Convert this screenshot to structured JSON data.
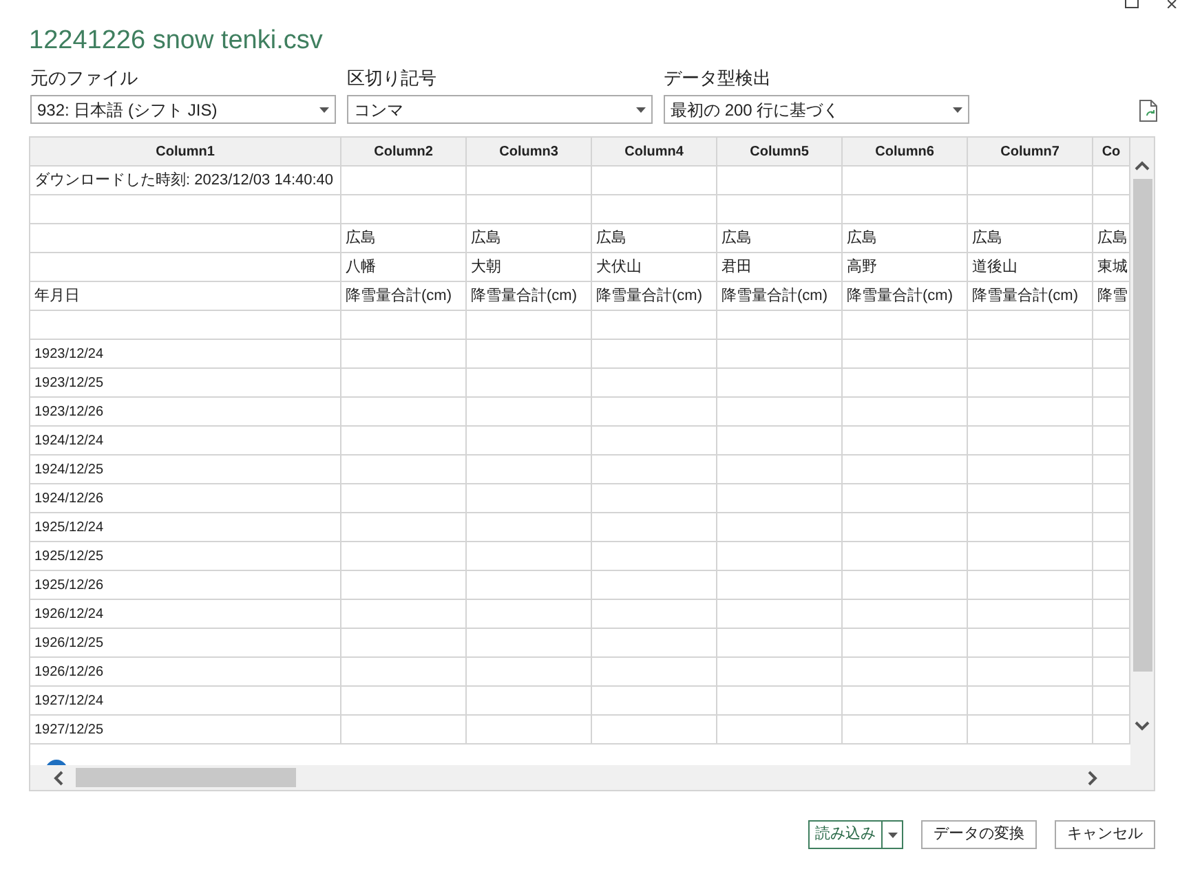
{
  "window": {
    "title": "12241226 snow tenki.csv"
  },
  "options": [
    {
      "label": "元のファイル",
      "value": "932: 日本語 (シフト JIS)"
    },
    {
      "label": "区切り記号",
      "value": "コンマ"
    },
    {
      "label": "データ型検出",
      "value": "最初の 200 行に基づく"
    }
  ],
  "table": {
    "columns": [
      "Column1",
      "Column2",
      "Column3",
      "Column4",
      "Column5",
      "Column6",
      "Column7",
      "Co"
    ],
    "rows": [
      [
        "ダウンロードした時刻: 2023/12/03 14:40:40",
        "",
        "",
        "",
        "",
        "",
        "",
        ""
      ],
      [
        "",
        "",
        "",
        "",
        "",
        "",
        "",
        ""
      ],
      [
        "",
        "広島",
        "広島",
        "広島",
        "広島",
        "広島",
        "広島",
        "広島"
      ],
      [
        "",
        "八幡",
        "大朝",
        "犬伏山",
        "君田",
        "高野",
        "道後山",
        "東城"
      ],
      [
        "年月日",
        "降雪量合計(cm)",
        "降雪量合計(cm)",
        "降雪量合計(cm)",
        "降雪量合計(cm)",
        "降雪量合計(cm)",
        "降雪量合計(cm)",
        "降雪"
      ],
      [
        "",
        "",
        "",
        "",
        "",
        "",
        "",
        ""
      ],
      [
        "1923/12/24",
        "",
        "",
        "",
        "",
        "",
        "",
        ""
      ],
      [
        "1923/12/25",
        "",
        "",
        "",
        "",
        "",
        "",
        ""
      ],
      [
        "1923/12/26",
        "",
        "",
        "",
        "",
        "",
        "",
        ""
      ],
      [
        "1924/12/24",
        "",
        "",
        "",
        "",
        "",
        "",
        ""
      ],
      [
        "1924/12/25",
        "",
        "",
        "",
        "",
        "",
        "",
        ""
      ],
      [
        "1924/12/26",
        "",
        "",
        "",
        "",
        "",
        "",
        ""
      ],
      [
        "1925/12/24",
        "",
        "",
        "",
        "",
        "",
        "",
        ""
      ],
      [
        "1925/12/25",
        "",
        "",
        "",
        "",
        "",
        "",
        ""
      ],
      [
        "1925/12/26",
        "",
        "",
        "",
        "",
        "",
        "",
        ""
      ],
      [
        "1926/12/24",
        "",
        "",
        "",
        "",
        "",
        "",
        ""
      ],
      [
        "1926/12/25",
        "",
        "",
        "",
        "",
        "",
        "",
        ""
      ],
      [
        "1926/12/26",
        "",
        "",
        "",
        "",
        "",
        "",
        ""
      ],
      [
        "1927/12/24",
        "",
        "",
        "",
        "",
        "",
        "",
        ""
      ],
      [
        "1927/12/25",
        "",
        "",
        "",
        "",
        "",
        "",
        ""
      ]
    ]
  },
  "buttons": [
    {
      "label": "読み込み",
      "kind": "split"
    },
    {
      "label": "データの変換",
      "kind": "plain"
    },
    {
      "label": "キャンセル",
      "kind": "plain"
    }
  ]
}
